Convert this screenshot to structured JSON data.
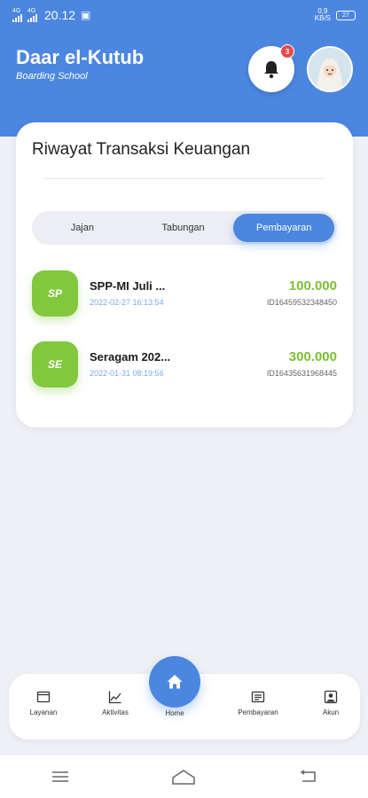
{
  "status_bar": {
    "time": "20.12",
    "sim1": "4G",
    "sim2": "4G",
    "right_label": "0,9\nKB/S",
    "battery": "27"
  },
  "header": {
    "title": "Daar el-Kutub",
    "subtitle": "Boarding School",
    "notification_count": "3",
    "bell_icon": "bell-icon",
    "avatar_icon": "avatar-hijab"
  },
  "card": {
    "title": "Riwayat Transaksi Keuangan",
    "tabs": [
      {
        "label": "Jajan",
        "active": false
      },
      {
        "label": "Tabungan",
        "active": false
      },
      {
        "label": "Pembayaran",
        "active": true
      }
    ],
    "transactions": [
      {
        "initials": "SP",
        "name": "SPP-MI Juli ...",
        "date": "2022-02-27 16:13:54",
        "amount": "100.000",
        "id": "ID16459532348450"
      },
      {
        "initials": "SE",
        "name": "Seragam 202...",
        "date": "2022-01-31 08:19:56",
        "amount": "300.000",
        "id": "ID16435631968445"
      }
    ]
  },
  "nav": {
    "items": [
      {
        "label": "Layanan",
        "icon": "window-icon"
      },
      {
        "label": "Aktivitas",
        "icon": "chart-icon"
      },
      {
        "label": "Home",
        "icon": "home-icon"
      },
      {
        "label": "Pembayaran",
        "icon": "receipt-icon"
      },
      {
        "label": "Akun",
        "icon": "user-icon"
      }
    ]
  },
  "colors": {
    "primary": "#4b86e0",
    "accent_green": "#82c83e",
    "amount_green": "#7cbf32",
    "badge_red": "#e84a4a"
  }
}
